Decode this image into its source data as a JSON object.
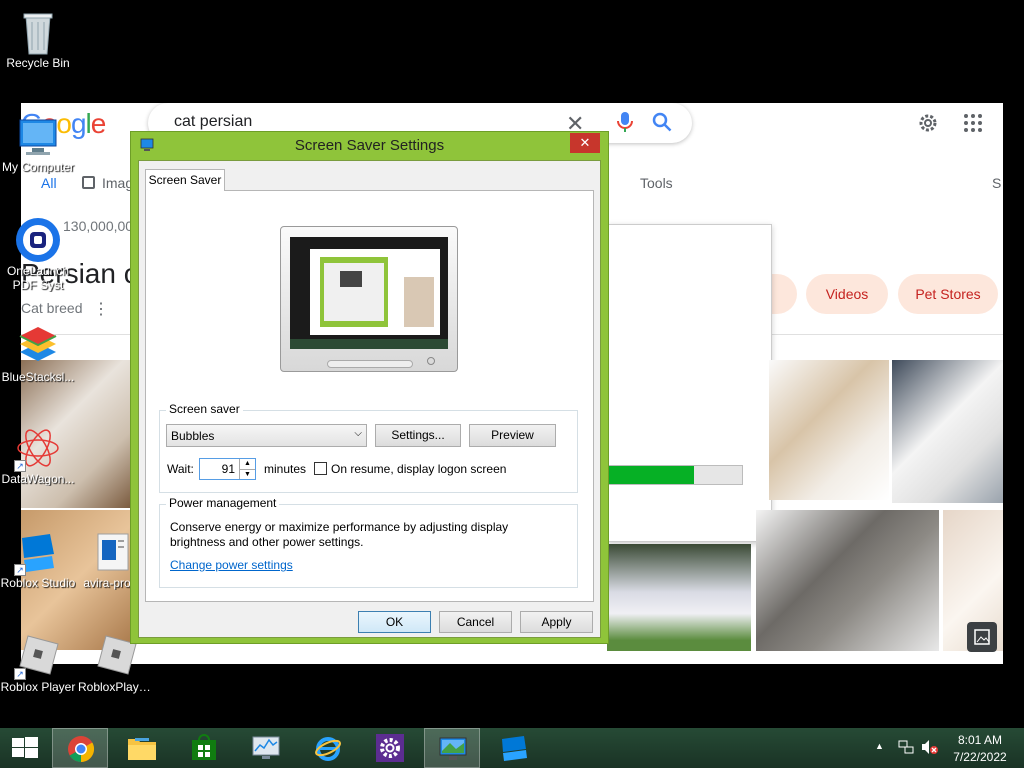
{
  "desktop_icons": [
    {
      "name": "recycle-bin",
      "label": "Recycle Bin"
    },
    {
      "name": "my-computer",
      "label": "My Computer"
    },
    {
      "name": "onelaunch",
      "label": "OneLaunch PDF Syst"
    },
    {
      "name": "bluestacks",
      "label": "BlueStacksl..."
    },
    {
      "name": "datawagon",
      "label": "DataWagon..."
    },
    {
      "name": "roblox-studio",
      "label": "Roblox Studio"
    },
    {
      "name": "avira",
      "label": "avira-pro..."
    },
    {
      "name": "roblox-player",
      "label": "Roblox Player"
    },
    {
      "name": "roblox-player-2",
      "label": "RobloxPlaye..."
    }
  ],
  "browser": {
    "logo": "Google",
    "search_query": "cat persian",
    "tabs": {
      "all": "All",
      "images": "Images",
      "tools": "Tools",
      "more": "S"
    },
    "result_count": "130,000,00",
    "knowledge_title": "Persian c",
    "knowledge_subtitle": "Cat breed",
    "chips": [
      "t",
      "Videos",
      "Pet Stores"
    ]
  },
  "dialog": {
    "title": "Screen Saver Settings",
    "close": "✕",
    "tab": "Screen Saver",
    "screensaver_group": "Screen saver",
    "selected_screensaver": "Bubbles",
    "settings_button": "Settings...",
    "preview_button": "Preview",
    "wait_label": "Wait:",
    "wait_value": "91",
    "minutes_label": "minutes",
    "resume_label": "On resume, display logon screen",
    "resume_checked": false,
    "power_group": "Power management",
    "power_text": "Conserve energy or maximize performance by adjusting display brightness and other power settings.",
    "power_link": "Change power settings",
    "ok": "OK",
    "cancel": "Cancel",
    "apply": "Apply"
  },
  "taskbar": {
    "time": "8:01 AM",
    "date": "7/22/2022",
    "items": [
      "start",
      "chrome",
      "file-explorer",
      "store",
      "resource-monitor",
      "internet-explorer",
      "settings",
      "screen-saver",
      "roblox"
    ]
  }
}
